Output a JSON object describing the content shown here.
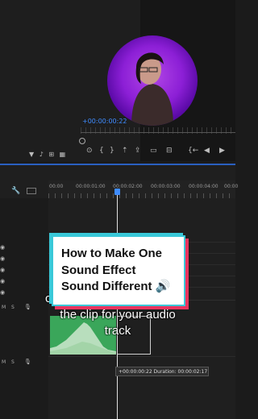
{
  "monitor": {
    "timecode": "+00:00:00:22",
    "controls": [
      "{←",
      "◀",
      "▶"
    ]
  },
  "timeline": {
    "ruler_ticks": [
      "00:00",
      "00:00:01:00",
      "00:00:02:00",
      "00:00:03:00",
      "00:00:04:00",
      "00:00"
    ],
    "tooltip": "+00:00:00:22  Duration: 00:00:02:17",
    "track_labels": [
      "M",
      "S"
    ]
  },
  "overlay": {
    "title_lines": [
      "How to Make One",
      "Sound Effect",
      "Sound Different 🔊"
    ],
    "subtitle_lines": [
      "the clip for your audio",
      "track"
    ],
    "subtitle_partial_left": "c",
    "subtitle_partial_right": "f"
  },
  "colors": {
    "accent": "#3f8cff",
    "card_shadow_pink": "#e8345f",
    "card_border_cyan": "#39c8d8",
    "clip_green": "#3aa65a",
    "webcam_purple": "#8c1fd6"
  }
}
